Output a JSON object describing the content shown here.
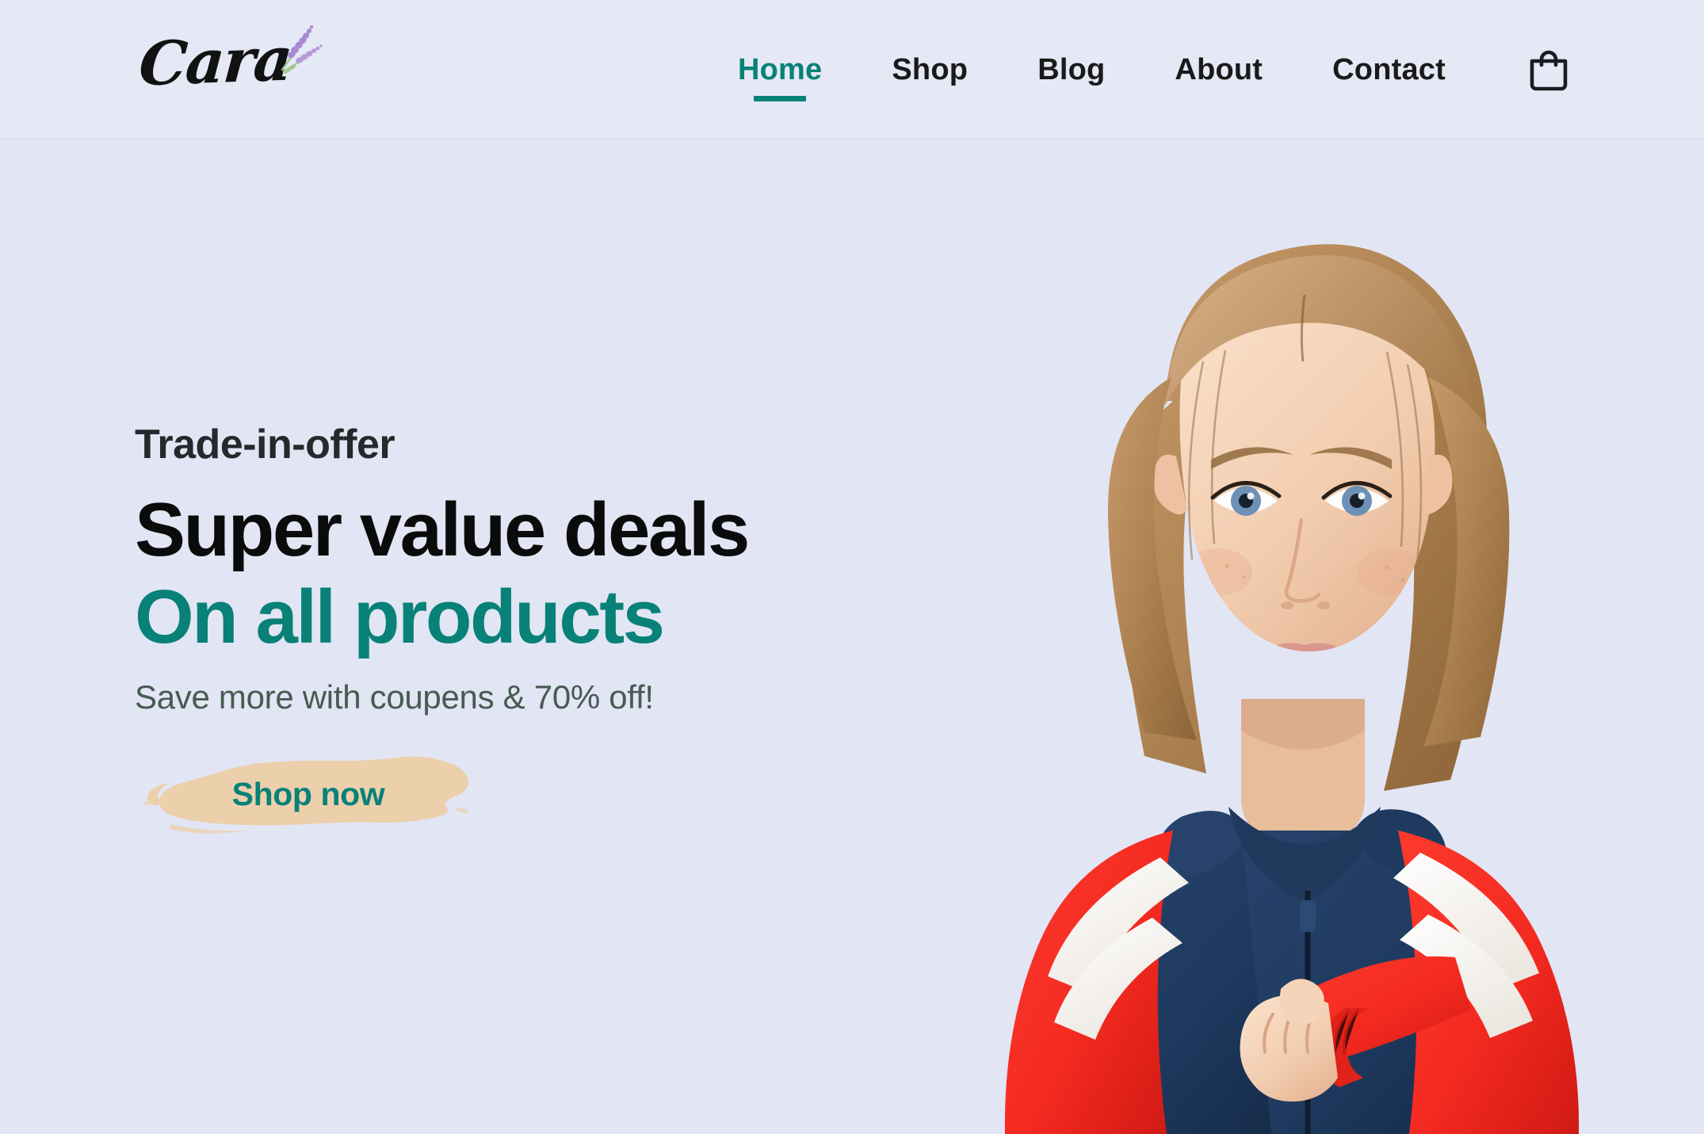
{
  "brand": {
    "name": "Cara",
    "logo_icon": "lavender-sprig-icon"
  },
  "header": {
    "background": "#e5e8f5",
    "nav": [
      {
        "label": "Home",
        "active": true,
        "icon": ""
      },
      {
        "label": "Shop",
        "active": false,
        "icon": ""
      },
      {
        "label": "Blog",
        "active": false,
        "icon": ""
      },
      {
        "label": "About",
        "active": false,
        "icon": ""
      },
      {
        "label": "Contact",
        "active": false,
        "icon": ""
      }
    ],
    "cart_icon": "shopping-bag-icon"
  },
  "hero": {
    "background": "#e2e5f3",
    "eyebrow": "Trade-in-offer",
    "headline_line1": "Super value deals",
    "headline_line2": "On all products",
    "subtext": "Save more with coupens & 70% off!",
    "cta_label": "Shop now",
    "cta_background": "#eccfab",
    "image_alt": "woman-in-navy-red-white-windbreaker-jacket"
  },
  "colors": {
    "accent_teal": "#088178",
    "text_dark": "#0b0b0b",
    "text_muted": "#465b52",
    "brush_tan": "#eccfab",
    "lavender_purple": "#a98ad0",
    "jacket_navy": "#1e3a5f",
    "jacket_red": "#f42a21",
    "jacket_white": "#f4f1ec"
  }
}
